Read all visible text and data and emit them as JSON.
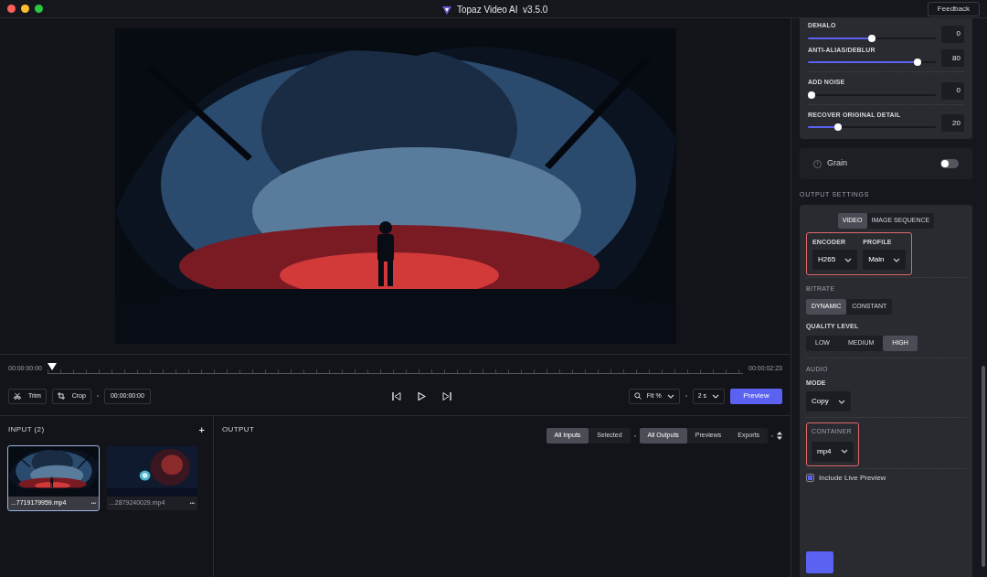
{
  "window": {
    "title": "Topaz Video AI  v3.5.0",
    "feedback": "Feedback"
  },
  "timeline": {
    "start": "00:00:00:00",
    "end": "00:00:02:23",
    "level": 0
  },
  "controls": {
    "trim": "Trim",
    "crop": "Crop",
    "time": "00:00:00:00",
    "fit": "Fit %",
    "interval": "2 s",
    "preview": "Preview"
  },
  "input": {
    "title": "INPUT (2)",
    "add": "+",
    "files": [
      {
        "name": "...7719179959.mp4",
        "selected": true,
        "more": "•••"
      },
      {
        "name": "...2879240029.mp4",
        "selected": false,
        "more": "•••"
      }
    ]
  },
  "output": {
    "title": "OUTPUT",
    "filter_groups": [
      [
        {
          "label": "All Inputs",
          "selected": true
        },
        {
          "label": "Selected",
          "selected": false
        }
      ],
      [
        {
          "label": "All Outputs",
          "selected": true
        },
        {
          "label": "Previews",
          "selected": false
        },
        {
          "label": "Exports",
          "selected": false
        }
      ]
    ]
  },
  "sliders": [
    {
      "label": "DEHALO",
      "value": "0",
      "level": 0.5
    },
    {
      "label": "ANTI-ALIAS/DEBLUR",
      "value": "80",
      "level": 0.88
    },
    {
      "label": "ADD NOISE",
      "value": "0",
      "level": 0
    },
    {
      "label": "RECOVER ORIGINAL DETAIL",
      "value": "20",
      "level": 0.22
    }
  ],
  "grain": {
    "label": "Grain",
    "on": false
  },
  "output_settings": {
    "title": "OUTPUT SETTINGS",
    "tabs": [
      {
        "label": "VIDEO",
        "selected": true
      },
      {
        "label": "IMAGE SEQUENCE",
        "selected": false
      }
    ],
    "codec": {
      "highlighted": true,
      "fields": [
        {
          "label": "ENCODER",
          "value": "H265"
        },
        {
          "label": "PROFILE",
          "value": "Main"
        }
      ]
    },
    "bitrate": {
      "title": "BITRATE",
      "options": [
        {
          "label": "DYNAMIC",
          "selected": true
        },
        {
          "label": "CONSTANT",
          "selected": false
        }
      ]
    },
    "quality": {
      "title": "QUALITY LEVEL",
      "options": [
        {
          "label": "LOW",
          "selected": false
        },
        {
          "label": "MEDIUM",
          "selected": false
        },
        {
          "label": "HIGH",
          "selected": true
        }
      ]
    },
    "audio": {
      "title": "AUDIO",
      "mode_label": "MODE",
      "mode": "Copy"
    },
    "container": {
      "highlighted": true,
      "title": "CONTAINER",
      "value": "mp4"
    },
    "live_preview": {
      "label": "Include Live Preview",
      "checked": true
    }
  }
}
